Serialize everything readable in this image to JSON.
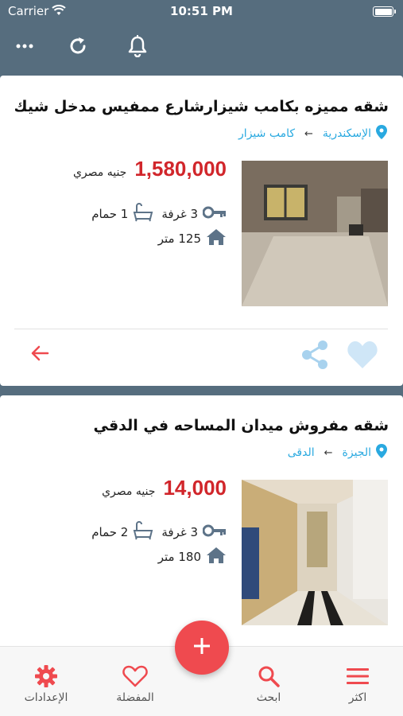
{
  "status": {
    "carrier": "Carrier",
    "time": "10:51 PM"
  },
  "listings": [
    {
      "title": "شقه مميزه بكامب شيزارشارع ممفيس مدخل شيك...",
      "city": "الإسكندرية",
      "district": "كامب شيزار",
      "price": "1,580,000",
      "currency": "جنيه مصري",
      "rooms": "3 غرفة",
      "baths": "1 حمام",
      "area": "125 متر"
    },
    {
      "title": "شقه مفروش ميدان المساحه في الدقي",
      "city": "الجيزة",
      "district": "الدقى",
      "price": "14,000",
      "currency": "جنيه مصري",
      "rooms": "3 غرفة",
      "baths": "2 حمام",
      "area": "180 متر"
    }
  ],
  "tabs": [
    {
      "label": "الإعدادات",
      "icon": "gear-icon"
    },
    {
      "label": "المفضلة",
      "icon": "heart-icon"
    },
    {
      "label": "ابحث",
      "icon": "search-icon"
    },
    {
      "label": "اكثر",
      "icon": "menu-icon"
    }
  ],
  "colors": {
    "header": "#566d7e",
    "price": "#d1262b",
    "accent": "#ef4a4f",
    "link": "#29a9e0",
    "icon": "#5d7388"
  }
}
